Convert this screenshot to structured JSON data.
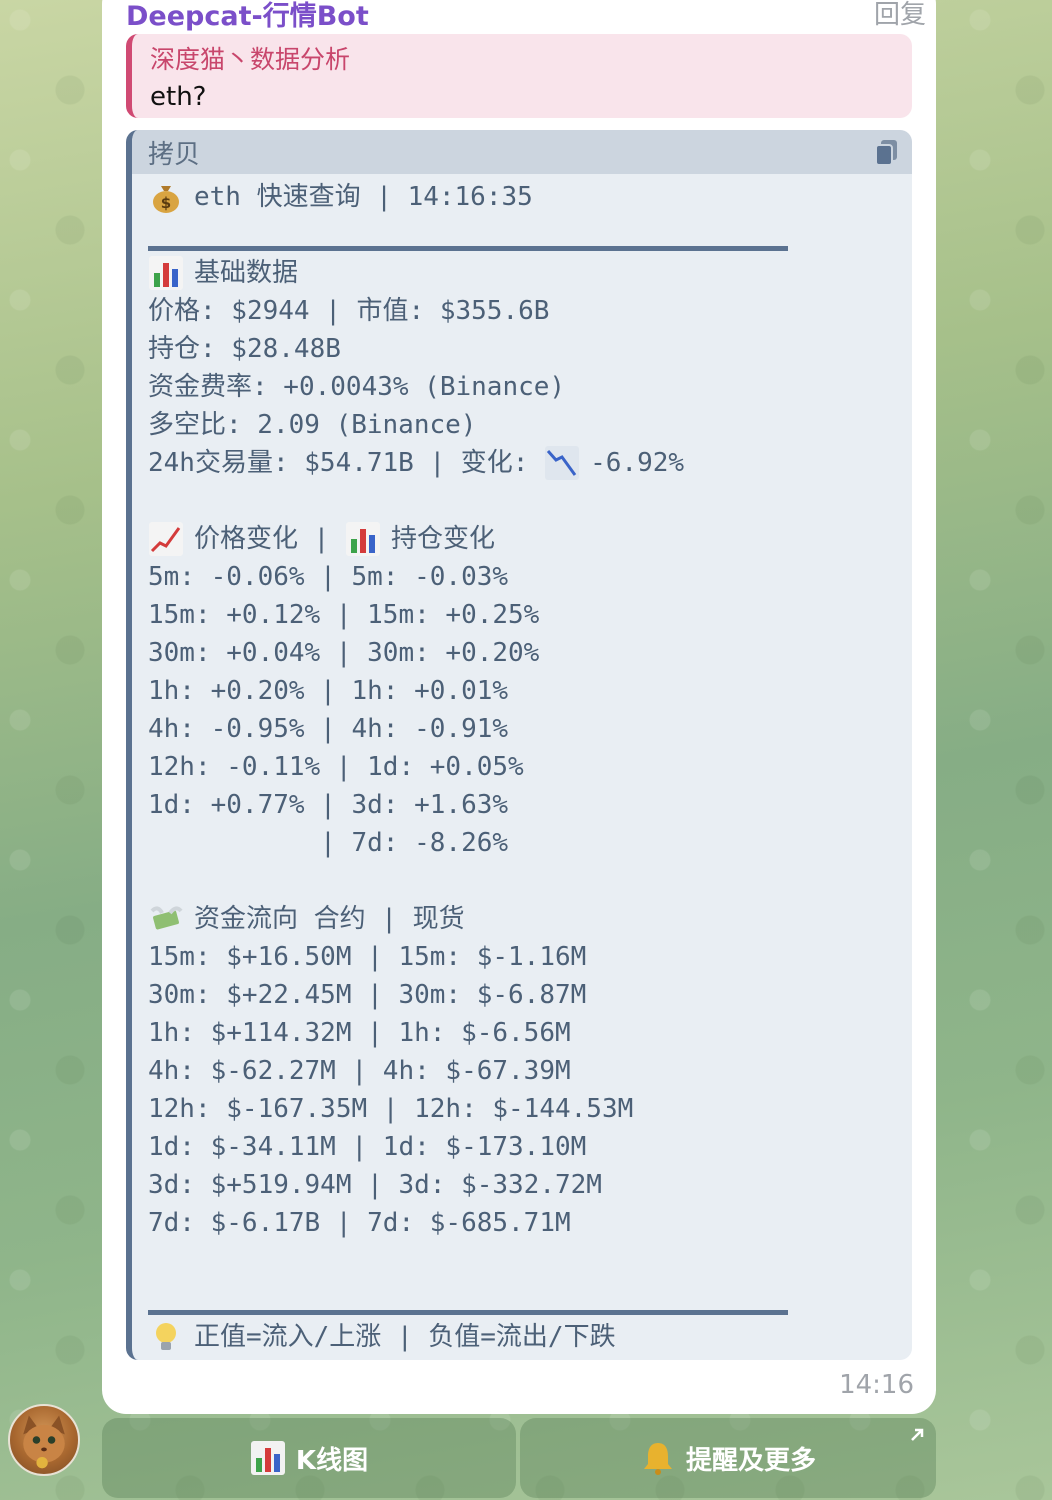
{
  "message": {
    "sender": "Deepcat-行情Bot",
    "reply_label": "回复",
    "quote": {
      "author": "深度猫丶数据分析",
      "text": "eth?"
    },
    "code_block": {
      "language_label": "拷贝",
      "lines": [
        {
          "icon": "money-bag-icon",
          "text": "eth 快速查询 | 14:16:35"
        },
        {
          "type": "rule"
        },
        {
          "icon": "bar-chart-icon",
          "text": "基础数据"
        },
        {
          "text": "价格: $2944 | 市值: $355.6B"
        },
        {
          "text": "持仓: $28.48B"
        },
        {
          "text": "资金费率: +0.0043% (Binance)"
        },
        {
          "text": "多空比: 2.09 (Binance)"
        },
        {
          "text": "24h交易量: $54.71B | 变化: ",
          "trail_icon": "chart-decreasing-icon",
          "trail_text": "-6.92%"
        },
        {
          "text": ""
        },
        {
          "icon": "chart-increasing-icon",
          "text": "价格变化 | ",
          "trail_icon": "bar-chart-icon",
          "trail_text": "持仓变化"
        },
        {
          "text": "5m: -0.06% | 5m: -0.03%"
        },
        {
          "text": "15m: +0.12% | 15m: +0.25%"
        },
        {
          "text": "30m: +0.04% | 30m: +0.20%"
        },
        {
          "text": "1h: +0.20% | 1h: +0.01%"
        },
        {
          "text": "4h: -0.95% | 4h: -0.91%"
        },
        {
          "text": "12h: -0.11% | 1d: +0.05%"
        },
        {
          "text": "1d: +0.77% | 3d: +1.63%"
        },
        {
          "text": "           | 7d: -8.26%"
        },
        {
          "text": ""
        },
        {
          "icon": "money-with-wings-icon",
          "text": "资金流向 合约 | 现货"
        },
        {
          "text": "15m: $+16.50M | 15m: $-1.16M"
        },
        {
          "text": "30m: $+22.45M | 30m: $-6.87M"
        },
        {
          "text": "1h: $+114.32M | 1h: $-6.56M"
        },
        {
          "text": "4h: $-62.27M | 4h: $-67.39M"
        },
        {
          "text": "12h: $-167.35M | 12h: $-144.53M"
        },
        {
          "text": "1d: $-34.11M | 1d: $-173.10M"
        },
        {
          "text": "3d: $+519.94M | 3d: $-332.72M"
        },
        {
          "text": "7d: $-6.17B | 7d: $-685.71M"
        },
        {
          "text": ""
        },
        {
          "type": "rule"
        },
        {
          "icon": "light-bulb-icon",
          "text": "正值=流入/上涨 | 负值=流出/下跌"
        }
      ]
    },
    "time": "14:16"
  },
  "keyboard": {
    "buttons": [
      {
        "icon": "bar-chart-icon",
        "label": "K线图"
      },
      {
        "icon": "bell-icon",
        "label": "提醒及更多",
        "corner_icon": "open-link-arrow-icon"
      }
    ]
  }
}
